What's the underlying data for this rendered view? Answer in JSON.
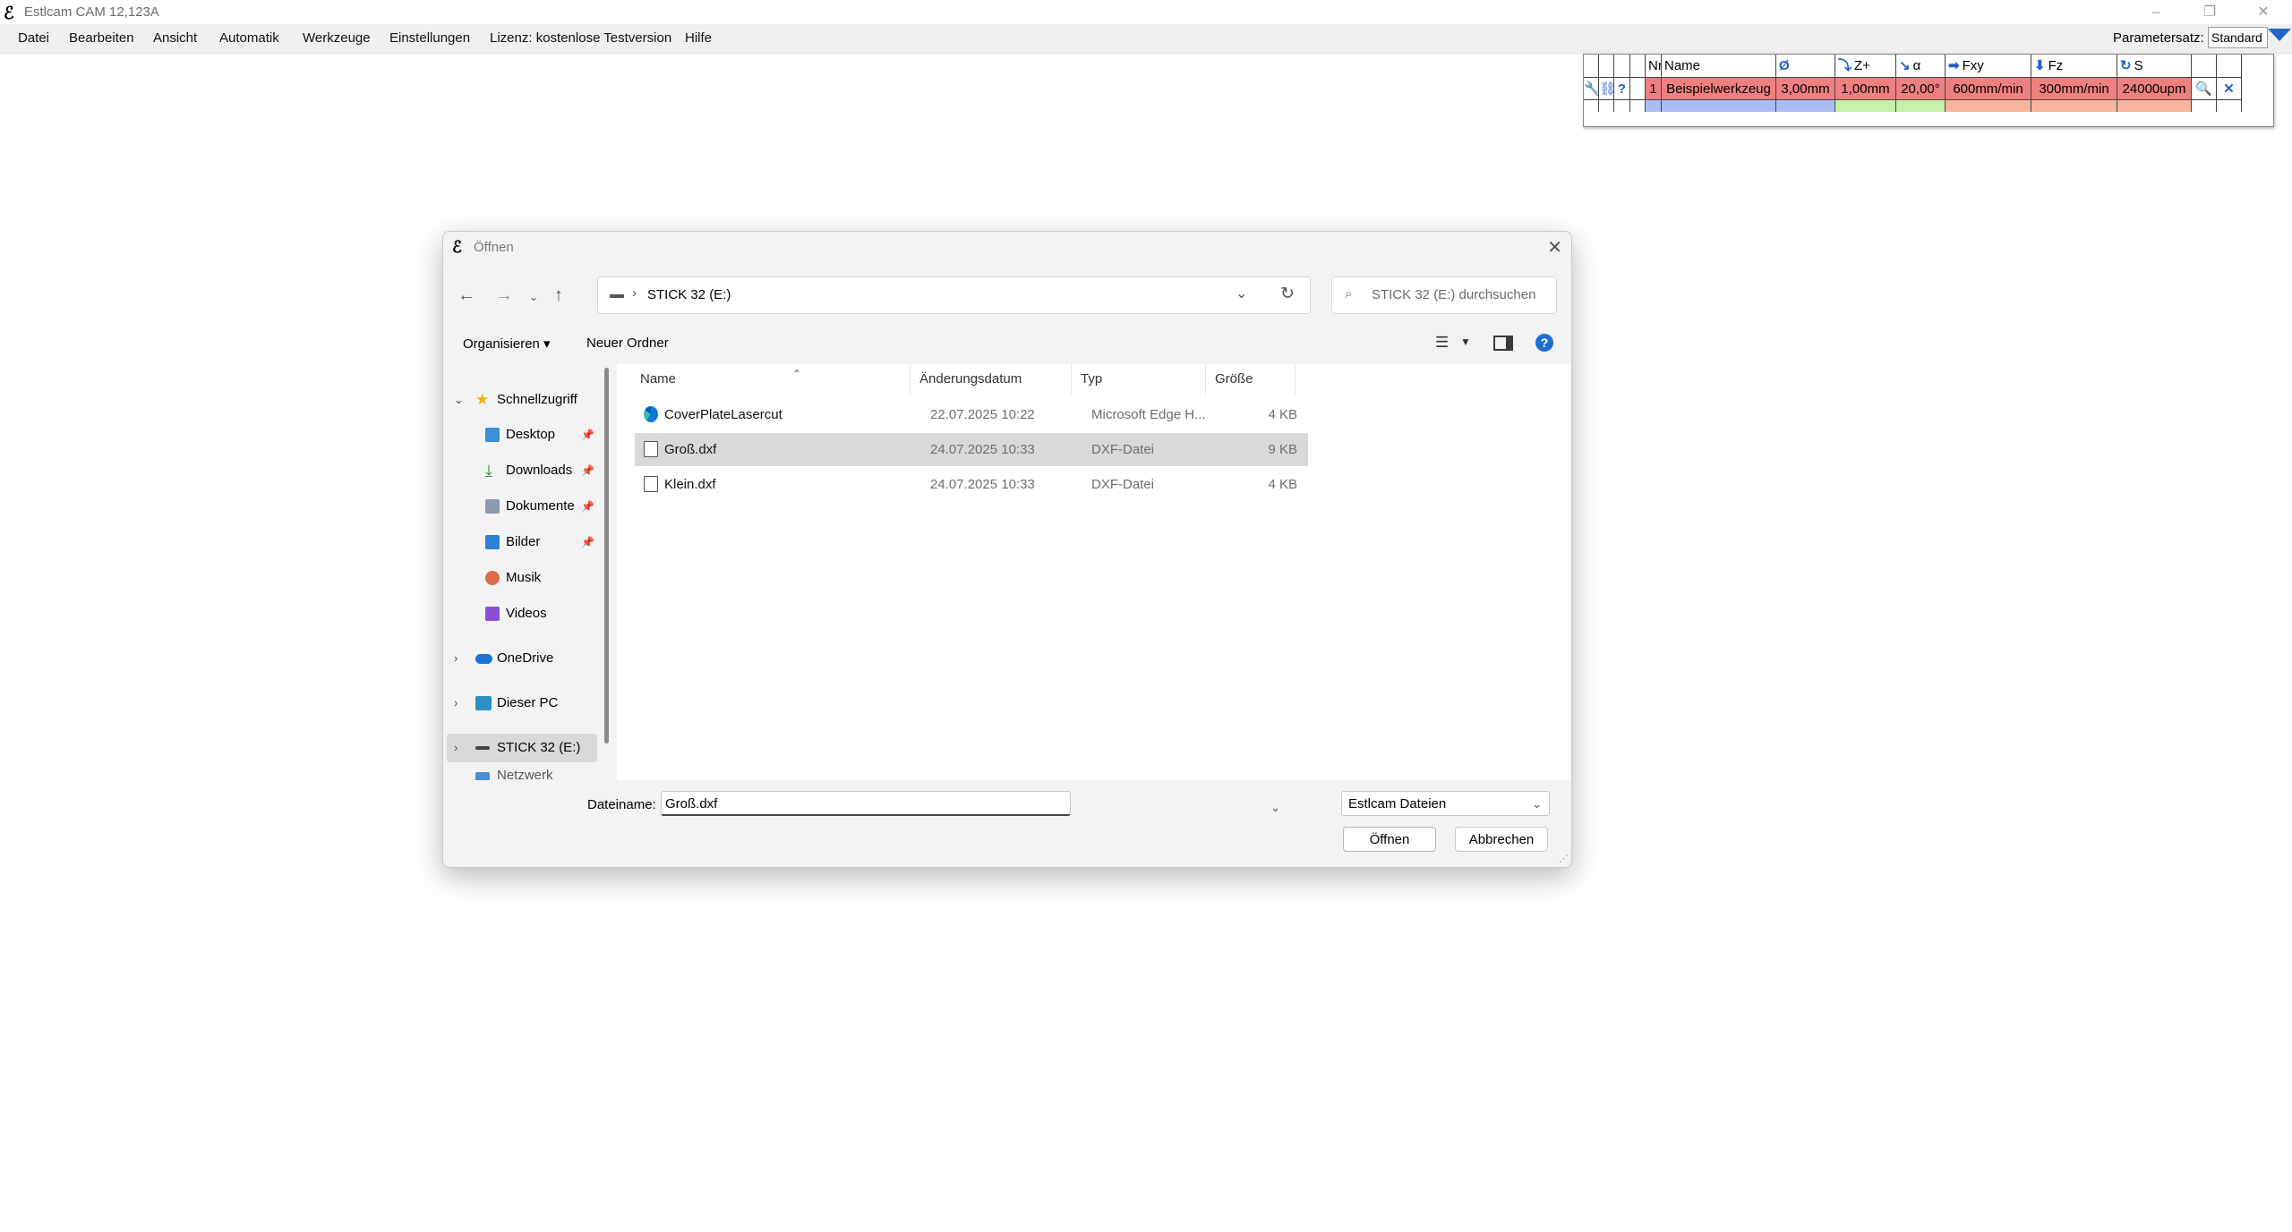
{
  "window": {
    "app_icon": "estlcam-logo-icon",
    "title": "Estlcam CAM 12,123A"
  },
  "menu": [
    "Datei",
    "Bearbeiten",
    "Ansicht",
    "Automatik",
    "Werkzeuge",
    "Einstellungen",
    "Lizenz: kostenlose Testversion",
    "Hilfe"
  ],
  "param": {
    "label": "Parametersatz:",
    "value": "Standard"
  },
  "tool_table": {
    "headers": [
      "Nr",
      "Name",
      "Ø",
      "Z+",
      "α",
      "Fxy",
      "Fz",
      "S"
    ],
    "row": {
      "nr": "1",
      "name": "Beispielwerkzeug",
      "diameter": "3,00mm",
      "zplus": "1,00mm",
      "angle": "20,00°",
      "fxy": "600mm/min",
      "fz": "300mm/min",
      "s": "24000upm"
    },
    "colors": {
      "red": "#f08080",
      "blue": "#aebcf4",
      "green": "#c5f0a8",
      "salmon": "#f8b59a"
    }
  },
  "dialog": {
    "title": "Öffnen",
    "address": "STICK 32 (E:)",
    "search_placeholder": "STICK 32 (E:) durchsuchen",
    "organize": "Organisieren ▾",
    "new_folder": "Neuer Ordner",
    "nav": {
      "quick_access": "Schnellzugriff",
      "items": [
        "Desktop",
        "Downloads",
        "Dokumente",
        "Bilder",
        "Musik",
        "Videos"
      ],
      "onedrive": "OneDrive",
      "this_pc": "Dieser PC",
      "drive": "STICK 32 (E:)",
      "network": "Netzwerk"
    },
    "columns": [
      "Name",
      "Änderungsdatum",
      "Typ",
      "Größe"
    ],
    "files": [
      {
        "name": "CoverPlateLasercut",
        "date": "22.07.2025 10:22",
        "type": "Microsoft Edge H...",
        "size": "4 KB",
        "icon": "edge-icon"
      },
      {
        "name": "Groß.dxf",
        "date": "24.07.2025 10:33",
        "type": "DXF-Datei",
        "size": "9 KB",
        "icon": "file-icon"
      },
      {
        "name": "Klein.dxf",
        "date": "24.07.2025 10:33",
        "type": "DXF-Datei",
        "size": "4 KB",
        "icon": "file-icon"
      }
    ],
    "filename_label": "Dateiname:",
    "filename_value": "Groß.dxf",
    "filetype": "Estlcam Dateien",
    "open_button": "Öffnen",
    "cancel_button": "Abbrechen"
  }
}
